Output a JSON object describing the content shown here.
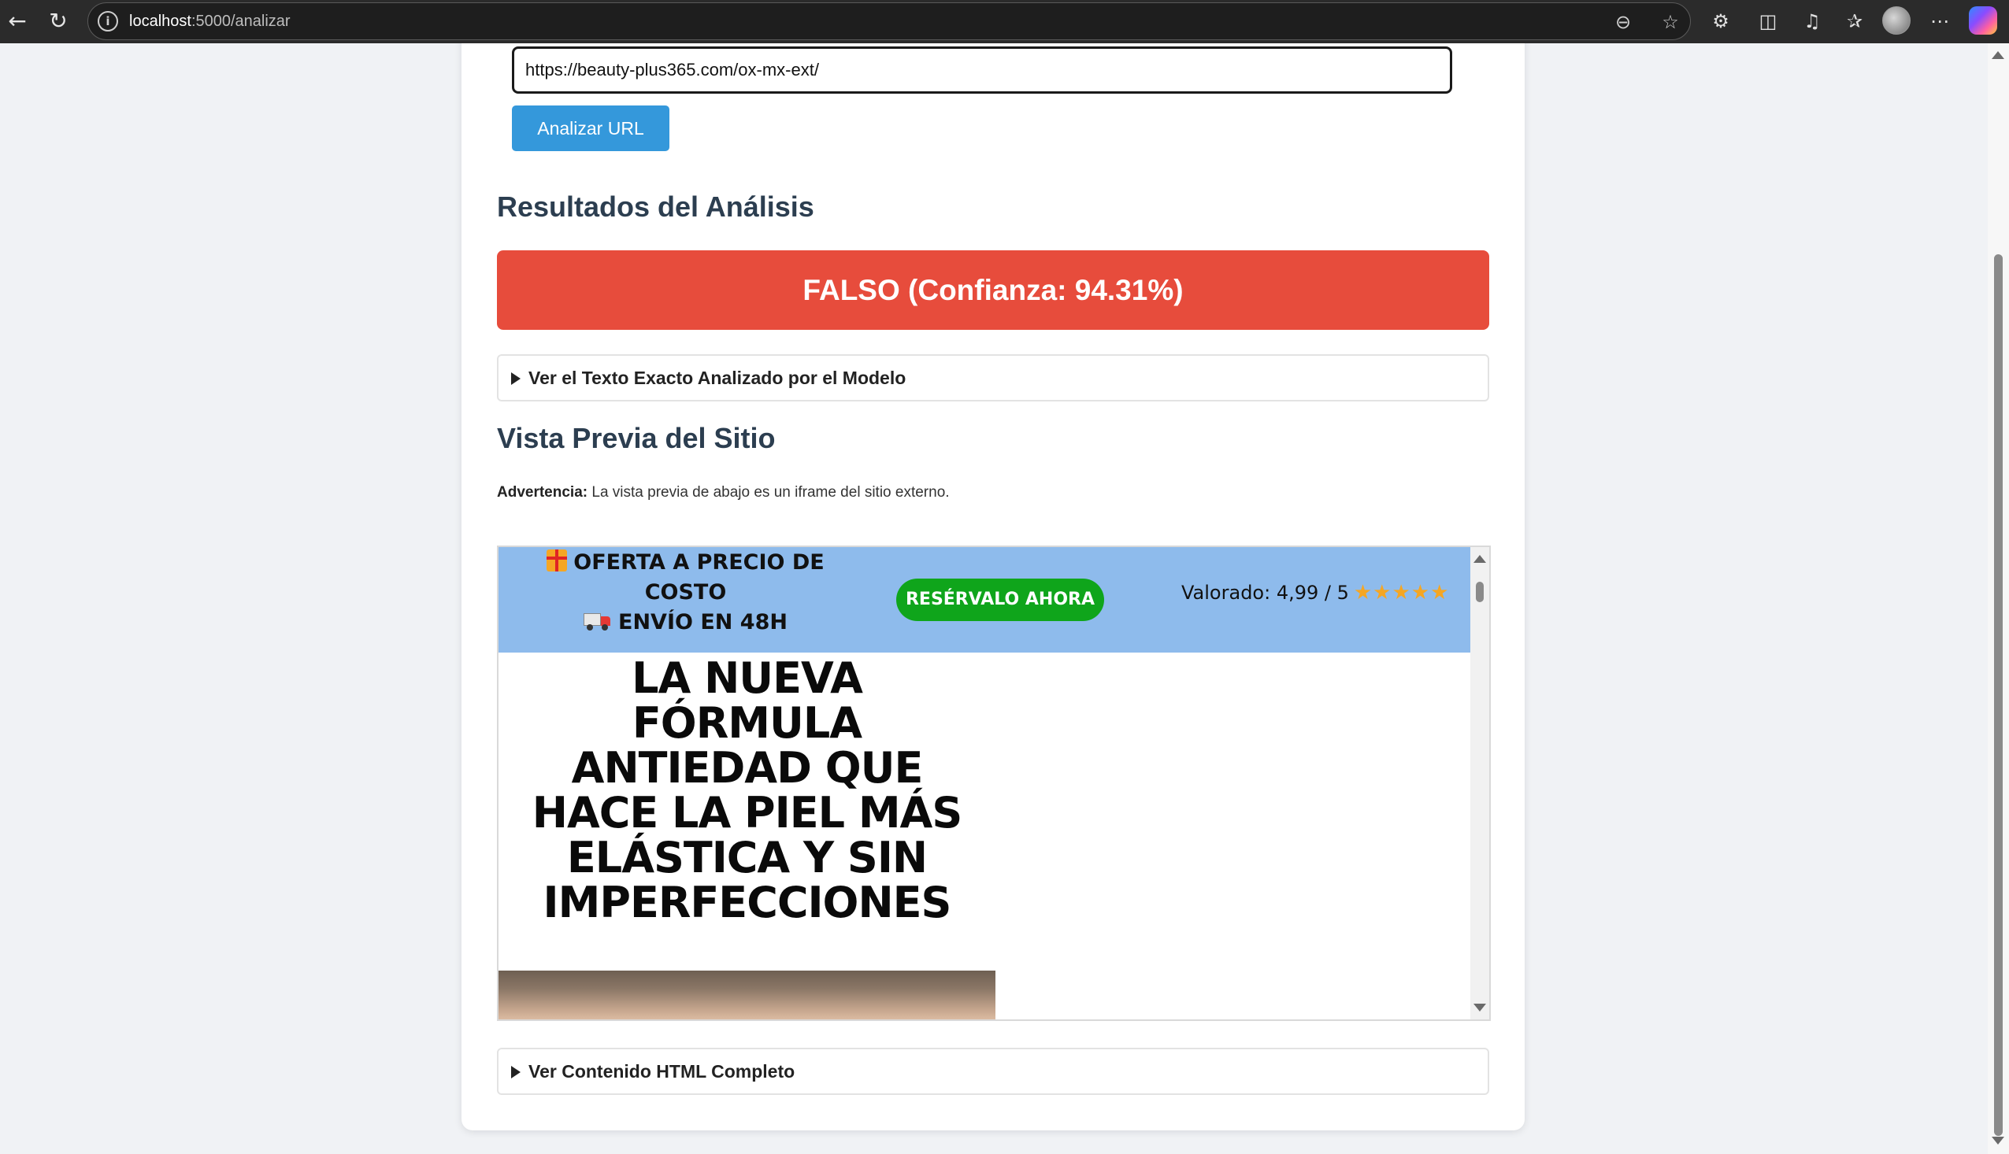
{
  "browser": {
    "url_host": "localhost",
    "url_path": ":5000/analizar"
  },
  "form": {
    "url_value": "https://beauty-plus365.com/ox-mx-ext/",
    "analyze_label": "Analizar URL"
  },
  "results": {
    "heading": "Resultados del Análisis",
    "verdict": "FALSO (Confianza: 94.31%)",
    "verdict_color": "#e74c3c",
    "text_details_label": "Ver el Texto Exacto Analizado por el Modelo"
  },
  "preview": {
    "heading": "Vista Previa del Sitio",
    "warning_label": "Advertencia:",
    "warning_text": "La vista previa de abajo es un iframe del sitio externo."
  },
  "iframe_site": {
    "promo_line1": "OFERTA A PRECIO DE",
    "promo_line2": "COSTO",
    "promo_line3": "ENVÍO EN 48H",
    "reserve_label": "RESÉRVALO AHORA",
    "rating_text": "Valorado: 4,99 / 5",
    "stars": "★★★★★",
    "headline_lines": [
      "LA NUEVA",
      "FÓRMULA",
      "ANTIEDAD QUE",
      "HACE LA PIEL MÁS",
      "ELÁSTICA Y SIN",
      "IMPERFECCIONES"
    ],
    "promo_bg": "#8ebbec",
    "reserve_bg": "#0fa51b"
  },
  "html_details_label": "Ver Contenido HTML Completo"
}
